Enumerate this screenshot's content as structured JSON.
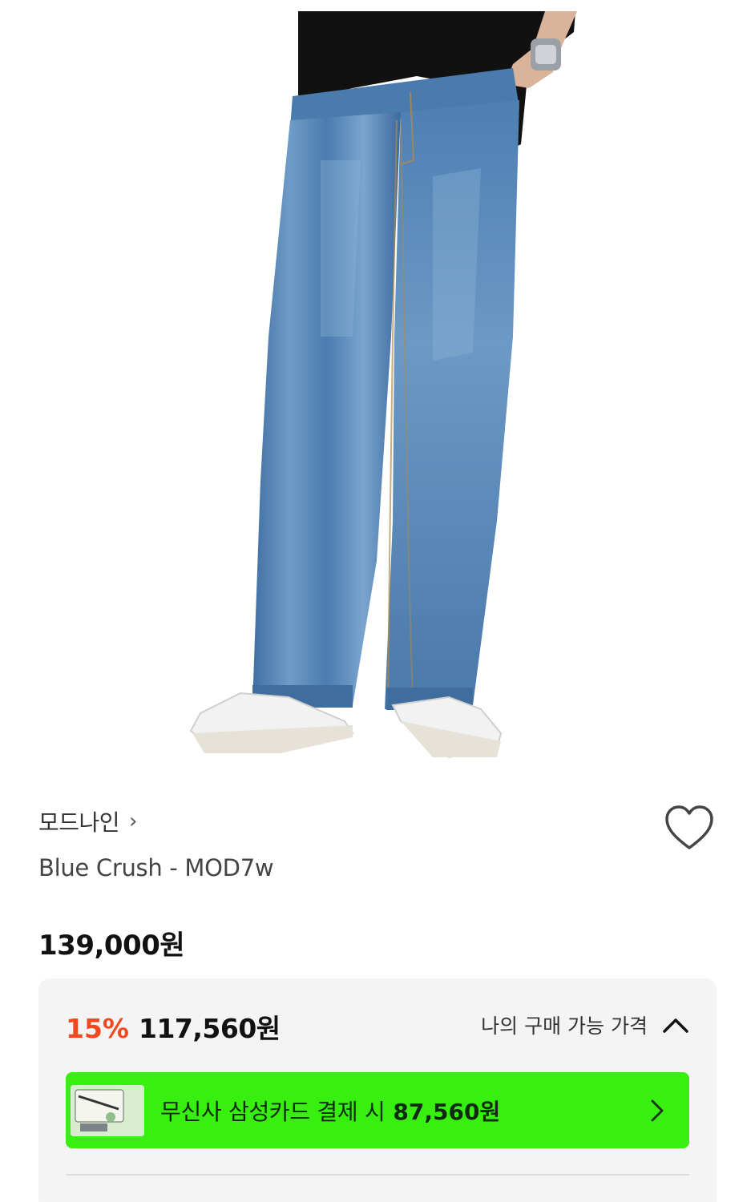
{
  "brand": {
    "name": "모드나인",
    "chevron": "›"
  },
  "product": {
    "name": "Blue Crush - MOD7w"
  },
  "price": {
    "original": "139,000원",
    "discount_rate": "15%",
    "discounted": "117,560원",
    "my_price_label": "나의 구매 가능 가격"
  },
  "card_promo": {
    "text": "무신사 삼성카드 결제 시",
    "price": "87,560원"
  },
  "colors": {
    "discount": "#f0481f",
    "promo_banner": "#38f00f",
    "price_box_bg": "#f4f4f4"
  },
  "icons": {
    "like": "heart-outline-icon",
    "toggle": "chevron-up-icon",
    "promo": "chevron-right-icon"
  }
}
